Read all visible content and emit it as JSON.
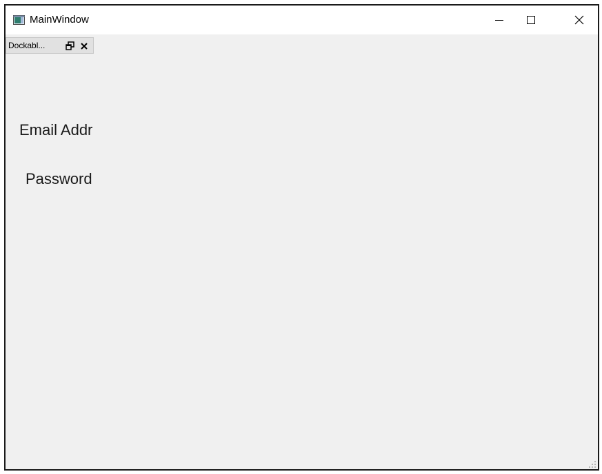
{
  "window": {
    "title": "MainWindow",
    "icons": {
      "app": "app-window-icon",
      "minimize": "minimize-icon",
      "maximize": "maximize-icon",
      "close": "close-icon"
    }
  },
  "dock": {
    "title": "Dockabl...",
    "icons": {
      "float": "float-icon",
      "close": "close-icon"
    }
  },
  "form": {
    "email_label": "Email Addr",
    "password_label": "Password"
  },
  "colors": {
    "client_background": "#f0f0f0",
    "titlebar_background": "#ffffff",
    "dock_tab_background": "#e1e1e1",
    "text": "#000000"
  }
}
